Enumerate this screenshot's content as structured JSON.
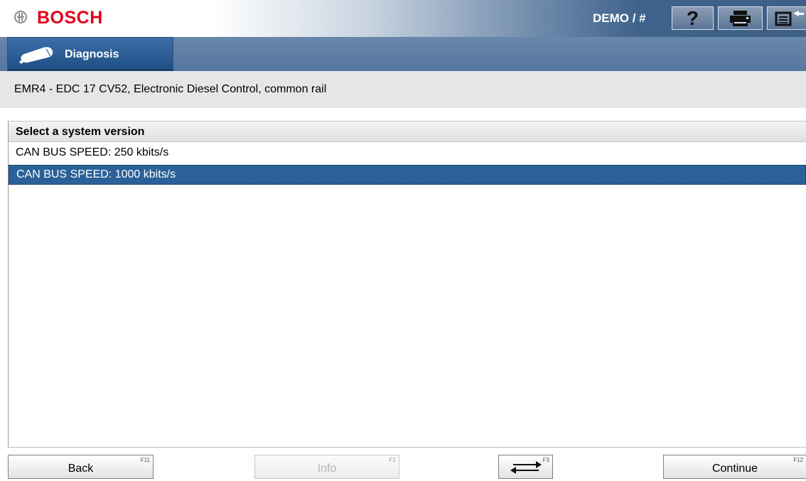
{
  "header": {
    "brand": "BOSCH",
    "user_text": "DEMO / #",
    "help_symbol": "?",
    "icons": [
      "bosch-logo-icon",
      "help-icon",
      "printer-icon",
      "menu-icon"
    ],
    "header_text_color": "#ffffff",
    "brand_color": "#e2001a"
  },
  "nav": {
    "diagnosis_label": "Diagnosis"
  },
  "subtitle": "EMR4 - EDC 17 CV52, Electronic Diesel Control, common rail",
  "list": {
    "header": "Select a system version",
    "items": [
      {
        "label": "CAN BUS SPEED: 250 kbits/s",
        "selected": false
      },
      {
        "label": "CAN BUS SPEED: 1000 kbits/s",
        "selected": true
      }
    ],
    "selected_color": "#2b6198"
  },
  "footer": {
    "back_label": "Back",
    "back_key": "F11",
    "info_label": "Info",
    "info_key": "F2",
    "info_enabled": false,
    "swap_key": "F3",
    "continue_label": "Continue",
    "continue_key": "F12"
  }
}
